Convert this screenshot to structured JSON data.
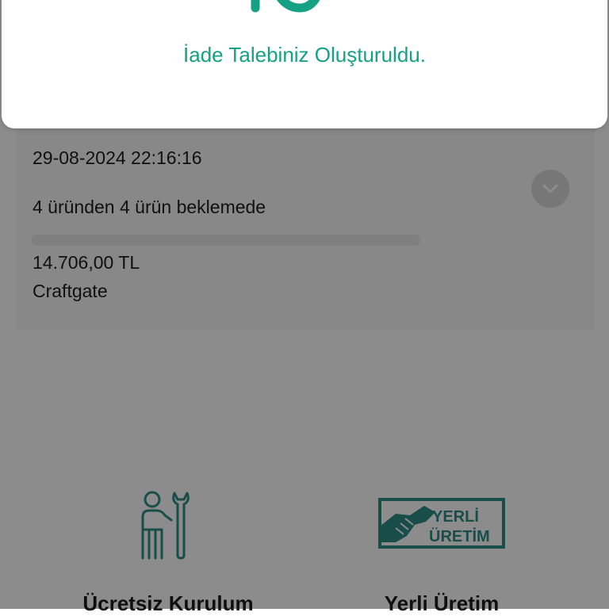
{
  "modal": {
    "message": "İade Talebiniz Oluşturuldu.",
    "icon": "success-check-icon",
    "accent_color": "#15a184"
  },
  "order": {
    "date": "29-08-2024 22:16:16",
    "status": "4 üründen 4 ürün beklemede",
    "progress": 0,
    "amount": "14.706,00 TL",
    "provider": "Craftgate",
    "expand_icon": "chevron-down-icon"
  },
  "features": [
    {
      "title": "Ücretsiz Kurulum",
      "icon": "installer-tools-icon"
    },
    {
      "title": "Yerli Üretim",
      "icon": "yerli-uretim-badge"
    }
  ],
  "badge": {
    "line1": "YERLİ",
    "line2": "ÜRETİM",
    "color": "#2c8d86"
  },
  "overlay": {
    "color": "rgba(0,0,0,0.45)"
  }
}
